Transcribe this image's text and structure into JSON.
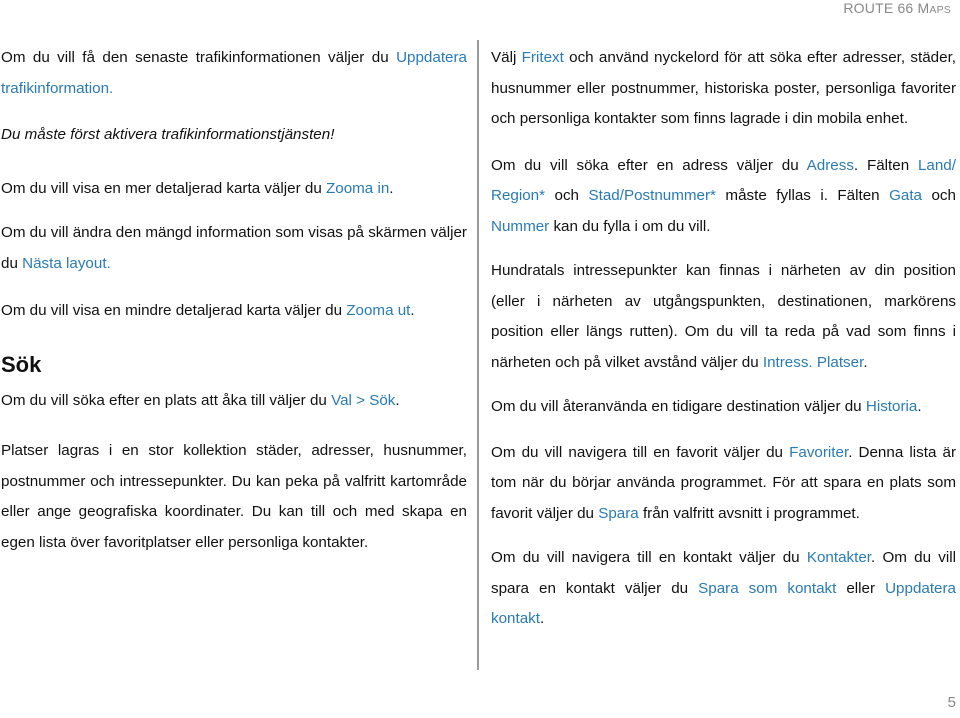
{
  "header": {
    "title_main": "ROUTE 66 M",
    "title_small": "APS"
  },
  "page_number": "5",
  "colors": {
    "link": "#2a7bb4",
    "text": "#111111",
    "muted": "#888888"
  },
  "left": {
    "p1": {
      "text": "Om du vill få den senaste trafikinformationen väljer du ",
      "link": "Uppdatera trafikinformation."
    },
    "p2": {
      "text": "Du måste först aktivera trafikinformationstjänsten!"
    },
    "p3": {
      "text": "Om du vill visa en mer detaljerad karta väljer du ",
      "link": "Zooma in",
      "after": "."
    },
    "p4": {
      "text": "Om du vill ändra den mängd information som visas på skärmen väljer du ",
      "link": "Nästa layout."
    },
    "p5": {
      "text": "Om du vill visa en mindre detaljerad karta väljer du ",
      "link": "Zooma ut",
      "after": "."
    },
    "heading": "Sök",
    "p6": {
      "text": "Om du vill söka efter en plats att åka till väljer du ",
      "link": "Val > Sök",
      "after": "."
    },
    "p7": {
      "text": "Platser lagras i en stor kollektion städer, adresser, husnummer, postnummer och intressepunkter. Du kan peka på valfritt kartområde eller ange geografiska koordinater. Du kan till och med skapa en egen lista över favoritplatser eller personliga kontakter."
    }
  },
  "right": {
    "p1": {
      "before": "Välj ",
      "link": "Fritext",
      "text": " och använd nyckelord för att söka efter adresser, städer, husnummer eller postnummer, historiska poster, personliga favoriter och personliga kontakter som finns lagrade i din mobila enhet."
    },
    "p2": {
      "t1": "Om du vill söka efter en adress väljer du ",
      "l1": "Adress",
      "t2": ". Fälten ",
      "l2": "Land/ Region*",
      "t3": " och ",
      "l3": "Stad/Postnummer*",
      "t4": " måste fyllas i. Fälten ",
      "l4": "Gata",
      "t5": " och ",
      "l5": "Nummer",
      "t6": " kan du fylla i om du vill."
    },
    "p3": {
      "text": "Hundratals intressepunkter kan finnas i närheten av din position (eller i närheten av utgångspunkten, destinationen, markörens position eller längs rutten). Om du vill ta reda på vad som finns i närheten och på vilket avstånd väljer du ",
      "link": "Intress. Platser",
      "after": "."
    },
    "p4": {
      "text": "Om du vill återanvända en tidigare destination väljer du ",
      "link": "Historia",
      "after": "."
    },
    "p5": {
      "text": "Om du vill navigera till en favorit väljer du ",
      "link": "Favoriter",
      "t2": ". Denna lista är tom när du börjar använda programmet. För att spara en plats som favorit väljer du ",
      "l2": "Spara",
      "t3": " från valfritt avsnitt i programmet."
    },
    "p6": {
      "text": "Om du vill navigera till en kontakt väljer du ",
      "link": "Kontakter",
      "t2": ". Om du vill spara en kontakt väljer du ",
      "l2": "Spara som kontakt",
      "t3": " eller ",
      "l3": "Uppdatera kontakt",
      "after": "."
    }
  }
}
